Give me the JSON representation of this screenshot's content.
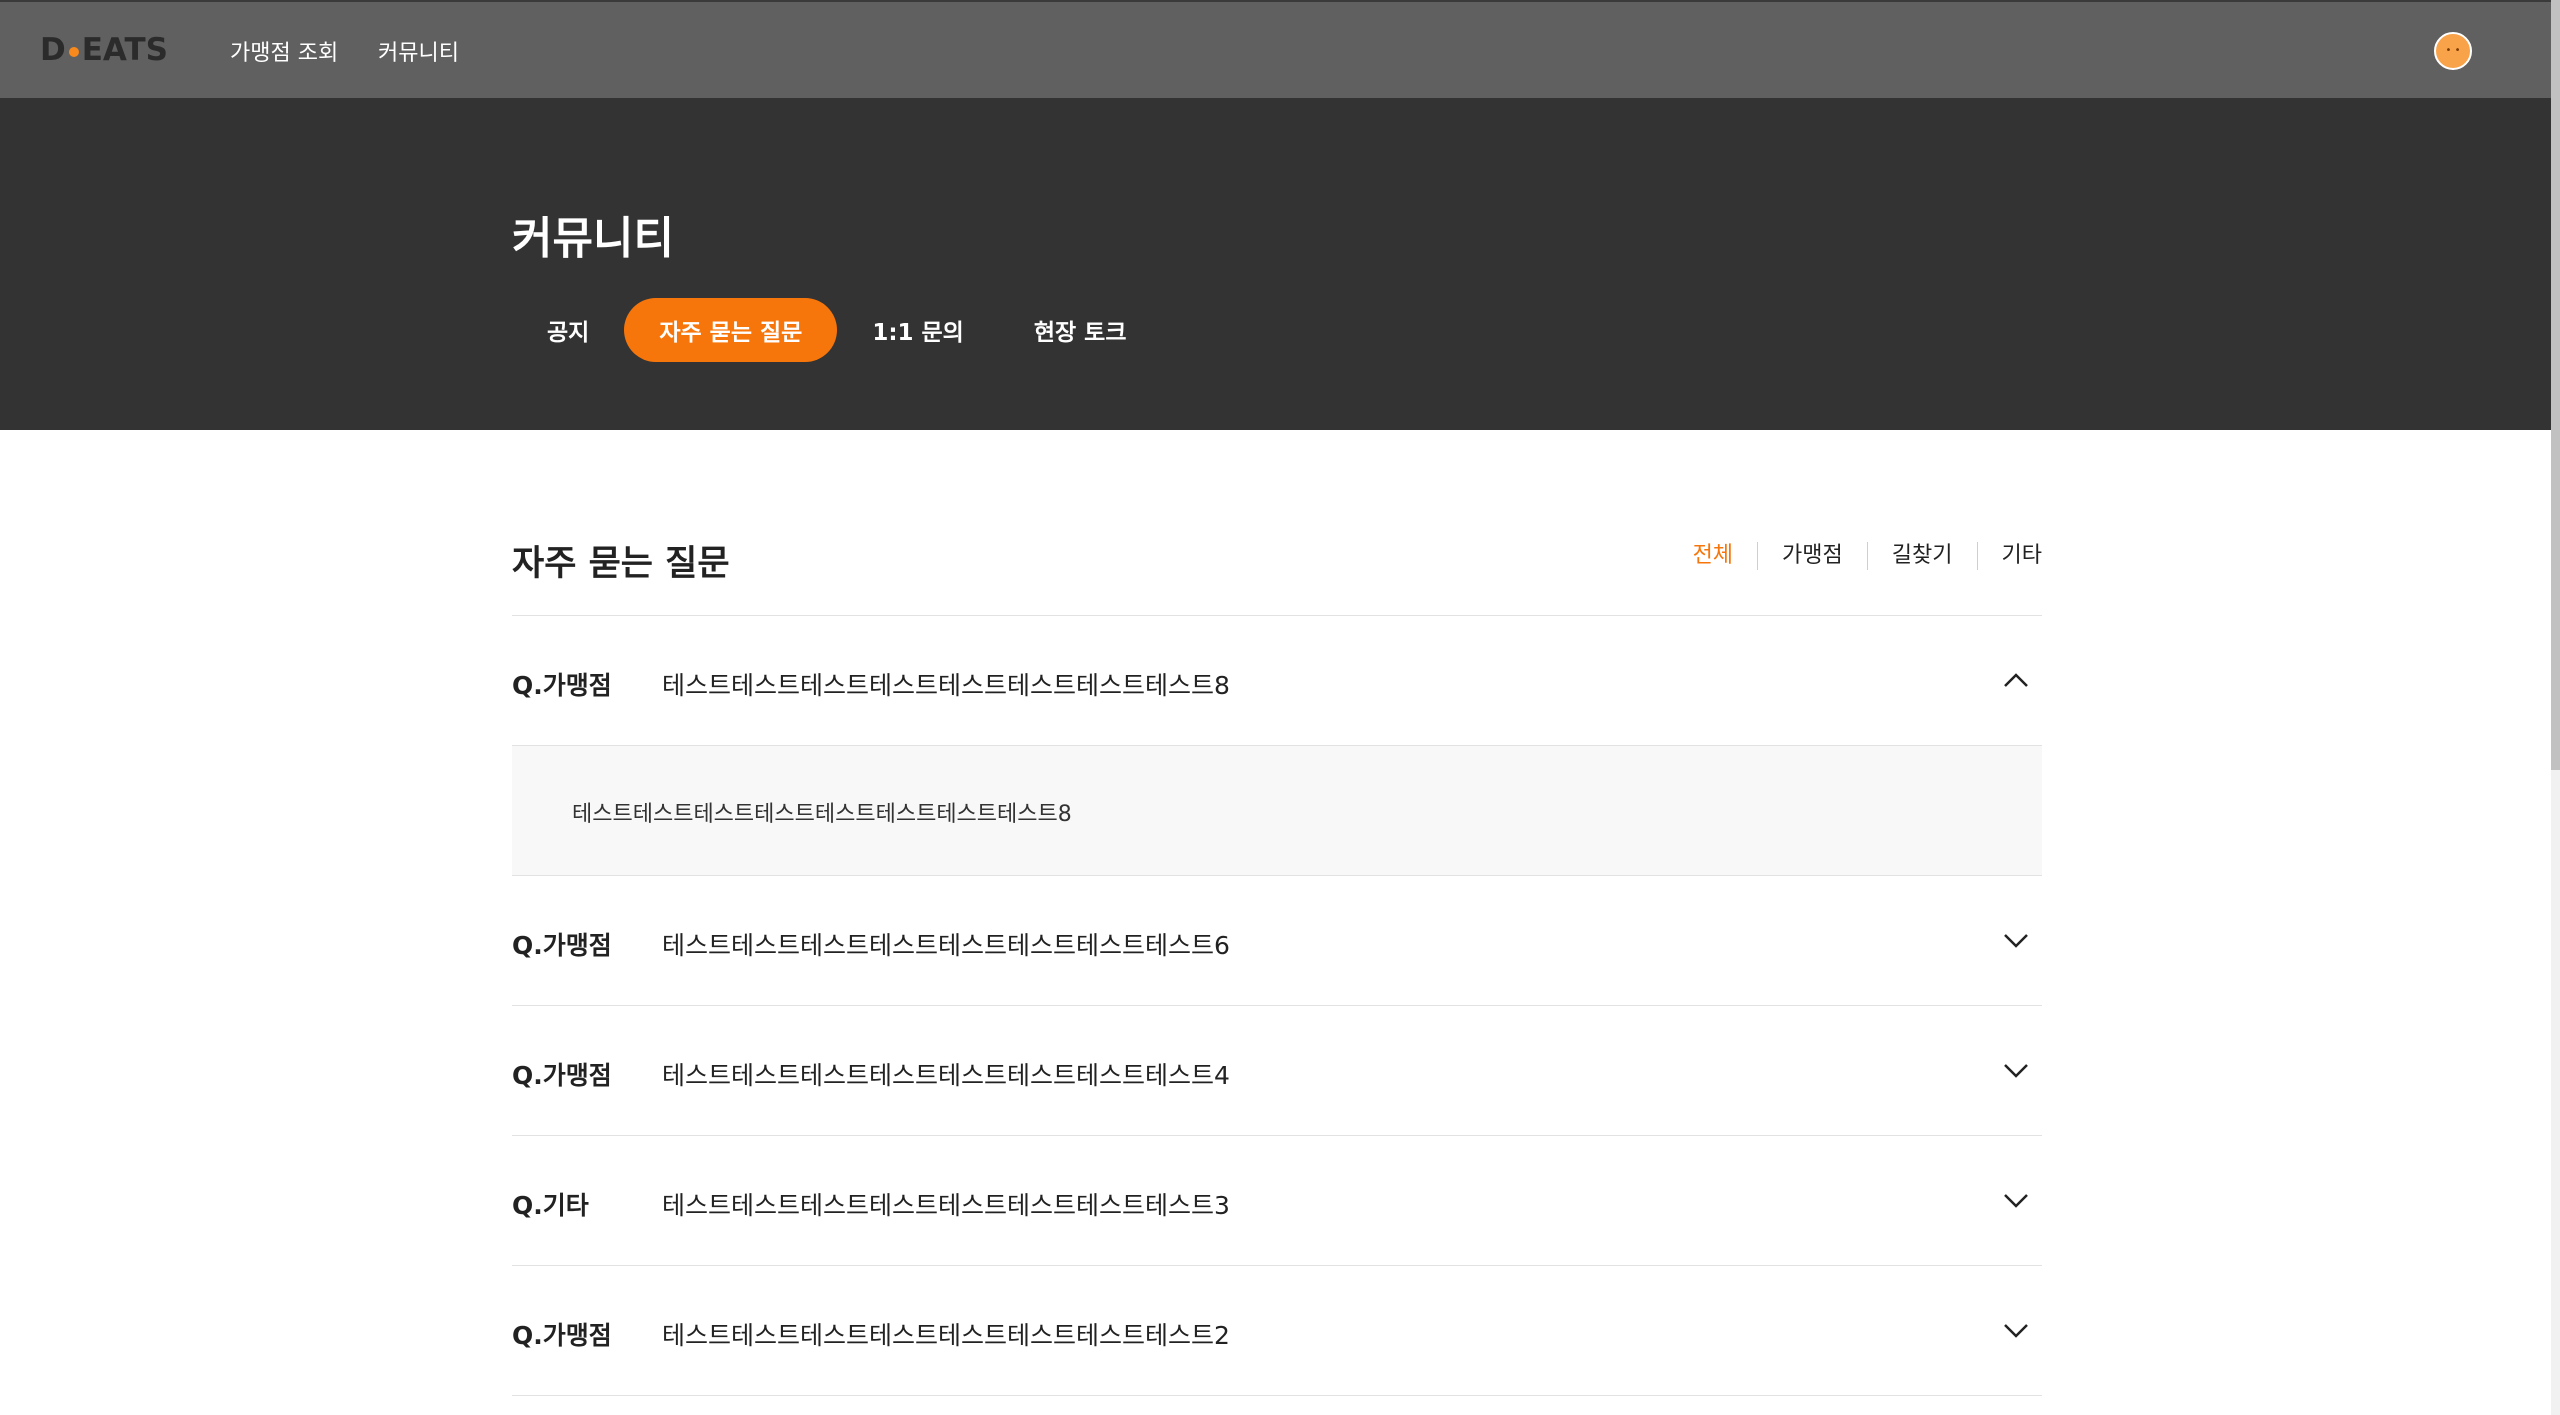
{
  "nav": {
    "logo_left": "D",
    "logo_right": "EATS",
    "links": [
      "가맹점 조회",
      "커뮤니티"
    ]
  },
  "hero": {
    "title": "커뮤니티",
    "tabs": [
      "공지",
      "자주 묻는 질문",
      "1:1 문의",
      "현장 토크"
    ],
    "active_tab": "자주 묻는 질문"
  },
  "faq": {
    "title": "자주 묻는 질문",
    "filters": [
      "전체",
      "가맹점",
      "길찾기",
      "기타"
    ],
    "active_filter": "전체",
    "items": [
      {
        "category": "Q.가맹점",
        "question": "테스트테스트테스트테스트테스트테스트테스트테스트8",
        "answer": "테스트테스트테스트테스트테스트테스트테스트테스트8",
        "expanded": true
      },
      {
        "category": "Q.가맹점",
        "question": "테스트테스트테스트테스트테스트테스트테스트테스트6",
        "expanded": false
      },
      {
        "category": "Q.가맹점",
        "question": "테스트테스트테스트테스트테스트테스트테스트테스트4",
        "expanded": false
      },
      {
        "category": "Q.기타",
        "question": "테스트테스트테스트테스트테스트테스트테스트테스트3",
        "expanded": false
      },
      {
        "category": "Q.가맹점",
        "question": "테스트테스트테스트테스트테스트테스트테스트테스트2",
        "expanded": false
      }
    ]
  },
  "colors": {
    "accent": "#f7760b",
    "nav_bg": "#606060",
    "hero_bg": "#333333"
  }
}
